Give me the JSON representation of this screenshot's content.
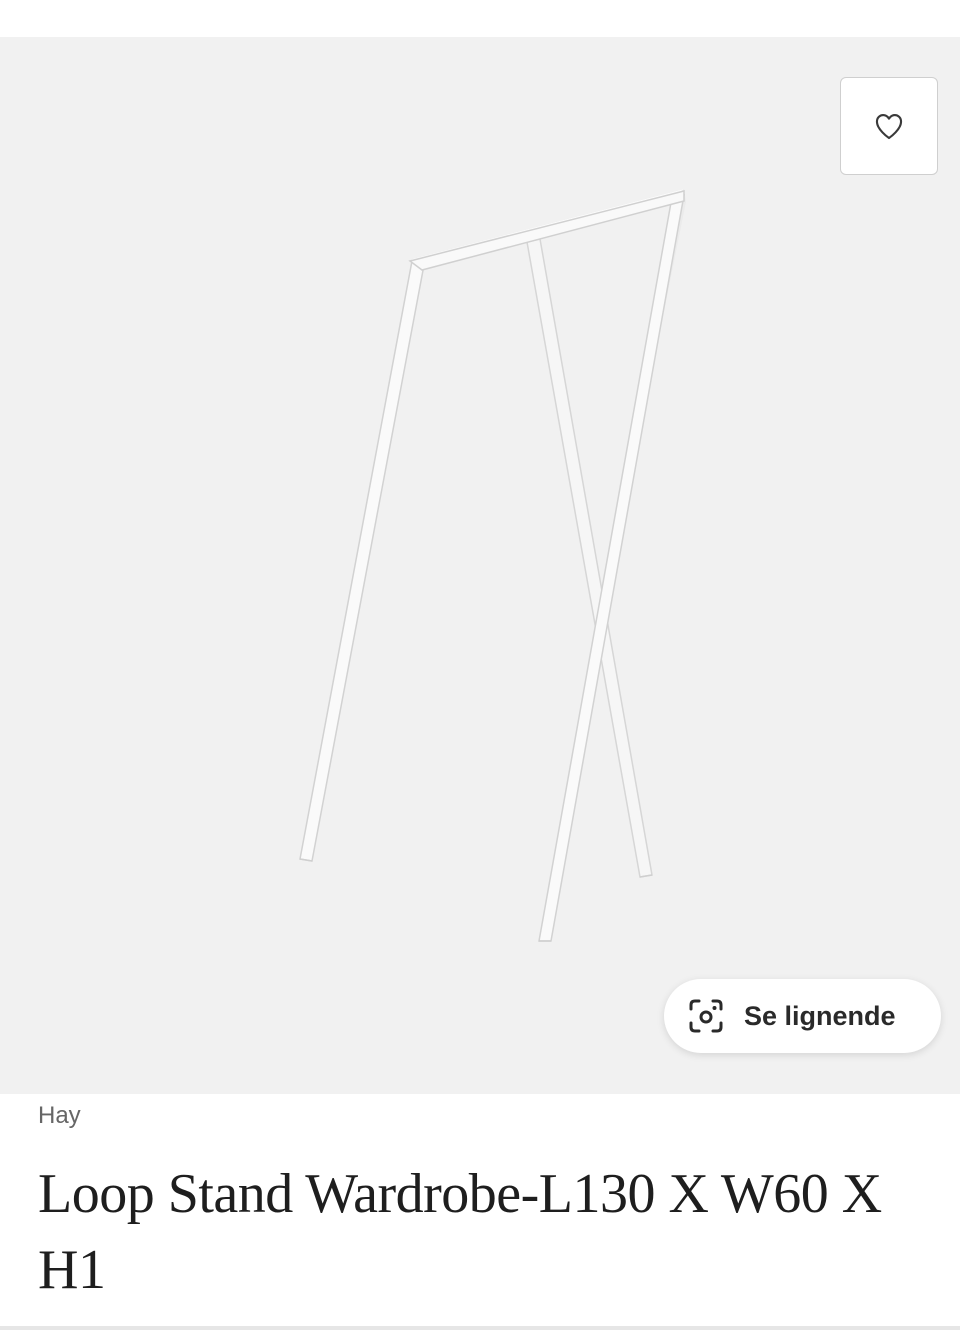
{
  "product": {
    "brand": "Hay",
    "title": "Loop Stand Wardrobe-L130 X W60 X H1"
  },
  "actions": {
    "favorite_icon": "heart-outline-icon",
    "lens_icon": "visual-search-icon",
    "lens_label": "Se lignende"
  },
  "colors": {
    "image_background": "#f1f1f1",
    "product_frame": "#f7f7f7"
  }
}
